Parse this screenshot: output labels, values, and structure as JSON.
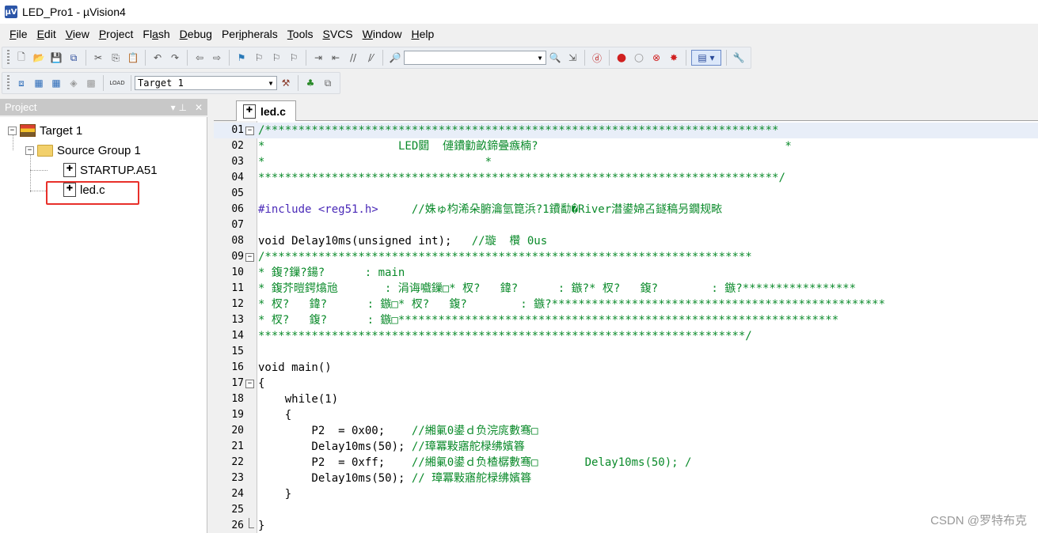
{
  "window": {
    "title": "LED_Pro1  - µVision4",
    "icon_label": "µV"
  },
  "menu": [
    {
      "label": "File",
      "key": "F",
      "rest": "ile"
    },
    {
      "label": "Edit",
      "key": "E",
      "rest": "dit"
    },
    {
      "label": "View",
      "key": "V",
      "rest": "iew"
    },
    {
      "label": "Project",
      "key": "P",
      "rest": "roject"
    },
    {
      "label": "Flash",
      "key": "",
      "rest": "Fl",
      "key2": "a",
      "rest2": "sh"
    },
    {
      "label": "Debug",
      "key": "D",
      "rest": "ebug"
    },
    {
      "label": "Peripherals",
      "key": "",
      "rest": "Per",
      "key2": "i",
      "rest2": "pherals"
    },
    {
      "label": "Tools",
      "key": "T",
      "rest": "ools"
    },
    {
      "label": "SVCS",
      "key": "S",
      "rest": "VCS"
    },
    {
      "label": "Window",
      "key": "W",
      "rest": "indow"
    },
    {
      "label": "Help",
      "key": "H",
      "rest": "elp"
    }
  ],
  "toolbar": {
    "find_combo_value": "",
    "target_combo_value": "Target 1",
    "load_label": "LOAD"
  },
  "project_panel": {
    "title": "Project",
    "pin": "▾  ⊥",
    "close": "✕",
    "tree": {
      "target": "Target 1",
      "group": "Source Group 1",
      "files": [
        "STARTUP.A51",
        "led.c"
      ]
    }
  },
  "editor": {
    "tab": "led.c",
    "lines": [
      {
        "n": "01",
        "fold": "−",
        "text": "/*****************************************************************************",
        "cls": "c-comment",
        "cur": true
      },
      {
        "n": "02",
        "text": "*                    LED閮  僆鐨勭畝鍗曡瘯楠?                                     *",
        "cls": "c-comment"
      },
      {
        "n": "03",
        "text": "*                                 *",
        "cls": "c-comment"
      },
      {
        "n": "04",
        "text": "******************************************************************************/",
        "cls": "c-comment"
      },
      {
        "n": "05",
        "text": "",
        "cls": "c-plain"
      },
      {
        "n": "06",
        "pre": "#include <reg51.h>     ",
        "text": "//姝ゅ枃浠朵腑瀹氫箟浜?1鐨勫�River澘鍙婂叾鐩稿叧鐗规畩",
        "cls": "c-comment",
        "pcls": "c-pp"
      },
      {
        "n": "07",
        "text": "",
        "cls": "c-plain"
      },
      {
        "n": "08",
        "pre": "void Delay10ms(unsigned int);   ",
        "text": "//璇  欑 0us",
        "cls": "c-comment",
        "pcls": "c-plain"
      },
      {
        "n": "09",
        "fold": "−",
        "text": "/*************************************************************************",
        "cls": "c-comment"
      },
      {
        "n": "10",
        "text": "* 鍑?鏁?鍚?      : main",
        "cls": "c-comment"
      },
      {
        "n": "11",
        "text": "* 鍑芥暟鍔熻兘       : 涓诲嚱鏁□* 杈?   鍏?      : 鏃?* 杈?   鍑?        : 鏃?*****************",
        "cls": "c-comment"
      },
      {
        "n": "12",
        "text": "* 杈?   鍏?      : 鏃□* 杈?   鍑?        : 鏃?**************************************************",
        "cls": "c-comment"
      },
      {
        "n": "13",
        "text": "* 杈?   鍑?      : 鏃□******************************************************************",
        "cls": "c-comment"
      },
      {
        "n": "14",
        "text": "*************************************************************************/",
        "cls": "c-comment"
      },
      {
        "n": "15",
        "text": "",
        "cls": "c-plain"
      },
      {
        "n": "16",
        "pre": "void main()",
        "text": "",
        "cls": "c-plain",
        "pcls": "c-plain"
      },
      {
        "n": "17",
        "fold": "−",
        "pre": "{",
        "text": "",
        "cls": "c-plain",
        "pcls": "c-plain"
      },
      {
        "n": "18",
        "pre": "    while(1)",
        "text": "",
        "cls": "c-plain",
        "pcls": "c-plain"
      },
      {
        "n": "19",
        "pre": "    {",
        "text": "",
        "cls": "c-plain",
        "pcls": "c-plain"
      },
      {
        "n": "20",
        "pre": "        P2  = 0x00;    ",
        "text": "//緗氭0鍙ｄ负浣庣數骞□",
        "cls": "c-comment",
        "pcls": "c-plain"
      },
      {
        "n": "21",
        "pre": "        Delay10ms(50); ",
        "text": "//璋冪敤寤舵椂绋嬪簭",
        "cls": "c-comment",
        "pcls": "c-plain"
      },
      {
        "n": "22",
        "pre": "        P2  = 0xff;    ",
        "text": "//緗氭0鍙ｄ负楂樼數骞□       Delay10ms(50); /",
        "cls": "c-comment",
        "pcls": "c-plain"
      },
      {
        "n": "23",
        "pre": "        Delay10ms(50); ",
        "text": "// 璋冪敤寤舵椂绋嬪簭",
        "cls": "c-comment",
        "pcls": "c-plain"
      },
      {
        "n": "24",
        "pre": "    }",
        "text": "",
        "cls": "c-plain",
        "pcls": "c-plain"
      },
      {
        "n": "25",
        "text": "",
        "cls": "c-plain"
      },
      {
        "n": "26",
        "foldend": true,
        "pre": "}",
        "text": "",
        "cls": "c-plain",
        "pcls": "c-plain"
      }
    ]
  },
  "watermark": "CSDN @罗特布克"
}
